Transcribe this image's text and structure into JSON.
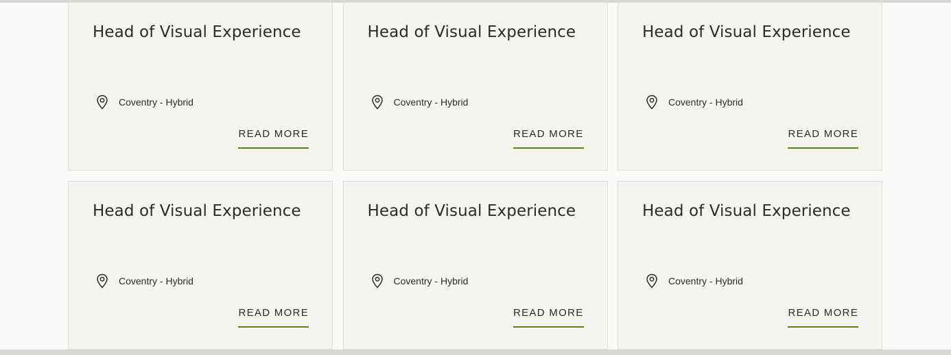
{
  "colors": {
    "card_background": "#f6f4ef",
    "accent_underline": "#5f7d1c",
    "text": "#2b2b2b"
  },
  "jobs": [
    {
      "title": "Head of Visual Experience",
      "location": "Coventry - Hybrid",
      "link_label": "READ MORE",
      "icon": "map-pin-icon"
    },
    {
      "title": "Head of Visual Experience",
      "location": "Coventry - Hybrid",
      "link_label": "READ MORE",
      "icon": "map-pin-icon"
    },
    {
      "title": "Head of Visual Experience",
      "location": "Coventry - Hybrid",
      "link_label": "READ MORE",
      "icon": "map-pin-icon"
    },
    {
      "title": "Head of Visual Experience",
      "location": "Coventry - Hybrid",
      "link_label": "READ MORE",
      "icon": "map-pin-icon"
    },
    {
      "title": "Head of Visual Experience",
      "location": "Coventry - Hybrid",
      "link_label": "READ MORE",
      "icon": "map-pin-icon"
    },
    {
      "title": "Head of Visual Experience",
      "location": "Coventry - Hybrid",
      "link_label": "READ MORE",
      "icon": "map-pin-icon"
    }
  ]
}
